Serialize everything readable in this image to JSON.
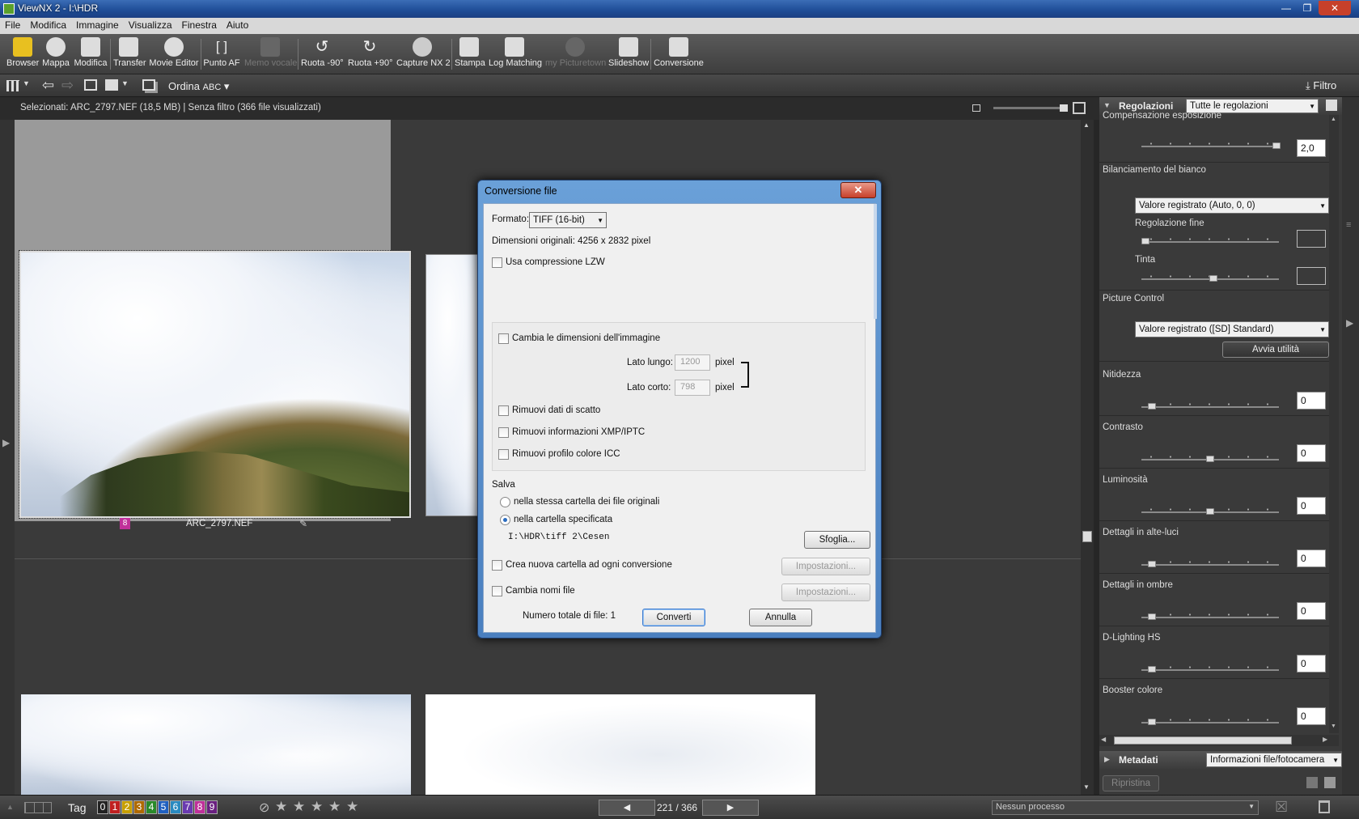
{
  "window": {
    "title": "ViewNX 2 - I:\\HDR"
  },
  "menu": [
    "File",
    "Modifica",
    "Immagine",
    "Visualizza",
    "Finestra",
    "Aiuto"
  ],
  "toolbar": {
    "buttons": [
      {
        "label": "Browser",
        "icon": "browser-icon"
      },
      {
        "label": "Mappa",
        "icon": "globe-icon"
      },
      {
        "label": "Modifica",
        "icon": "edit-icon"
      },
      {
        "label": "Transfer",
        "icon": "camera-icon"
      },
      {
        "label": "Movie Editor",
        "icon": "film-icon"
      },
      {
        "label": "Punto AF",
        "icon": "af-point-icon"
      },
      {
        "label": "Memo vocale",
        "icon": "voice-memo-icon",
        "disabled": true
      },
      {
        "label": "Ruota -90°",
        "icon": "rotate-left-icon"
      },
      {
        "label": "Ruota +90°",
        "icon": "rotate-right-icon"
      },
      {
        "label": "Capture NX 2",
        "icon": "nx-icon"
      },
      {
        "label": "Stampa",
        "icon": "print-icon"
      },
      {
        "label": "Log Matching",
        "icon": "log-matching-icon"
      },
      {
        "label": "my Picturetown",
        "icon": "picturetown-icon",
        "disabled": true
      },
      {
        "label": "Slideshow",
        "icon": "slideshow-icon"
      },
      {
        "label": "Conversione",
        "icon": "convert-icon"
      }
    ],
    "sort_label": "Ordina",
    "sort_value": "ABC",
    "filter_label": "Filtro"
  },
  "status": {
    "text": "Selezionati: ARC_2797.NEF (18,5 MB) | Senza filtro  (366 file visualizzati)"
  },
  "thumbnails": [
    {
      "name": "ARC_2797.NEF",
      "label": "8",
      "selected": true
    }
  ],
  "dialog": {
    "title": "Conversione file",
    "format_label": "Formato:",
    "format_value": "TIFF (16-bit)",
    "original_dims": "Dimensioni originali: 4256 x 2832 pixel",
    "lzw_label": "Usa compressione LZW",
    "resize_label": "Cambia le dimensioni dell'immagine",
    "long_side_label": "Lato lungo:",
    "long_side_value": "1200",
    "short_side_label": "Lato corto:",
    "short_side_value": "798",
    "pixel_unit": "pixel",
    "remove_shot_data": "Rimuovi dati di scatto",
    "remove_xmp": "Rimuovi informazioni XMP/IPTC",
    "remove_icc": "Rimuovi profilo colore ICC",
    "save_label": "Salva",
    "save_same_folder": "nella stessa cartella dei file originali",
    "save_specified": "nella cartella specificata",
    "save_path": "I:\\HDR\\tiff 2\\Cesen",
    "browse_button": "Sfoglia...",
    "new_folder_label": "Crea nuova cartella ad ogni conversione",
    "settings_button": "Impostazioni...",
    "rename_label": "Cambia nomi file",
    "total_files": "Numero totale di file: 1",
    "convert_button": "Converti",
    "cancel_button": "Annulla"
  },
  "panel": {
    "title": "Regolazioni",
    "preset": "Tutte le regolazioni",
    "exposure_label": "Compensazione esposizione",
    "exposure_value": "2,0",
    "wb_label": "Bilanciamento del bianco",
    "wb_value": "Valore registrato (Auto, 0, 0)",
    "fine_label": "Regolazione fine",
    "tint_label": "Tinta",
    "pc_label": "Picture Control",
    "pc_value": "Valore registrato ([SD] Standard)",
    "utility_button": "Avvia utilità",
    "sliders": [
      {
        "label": "Nitidezza",
        "value": "0",
        "pos": 0.05
      },
      {
        "label": "Contrasto",
        "value": "0",
        "pos": 0.5
      },
      {
        "label": "Luminosità",
        "value": "0",
        "pos": 0.5
      },
      {
        "label": "Dettagli in alte-luci",
        "value": "0",
        "pos": 0.05
      },
      {
        "label": "Dettagli in ombre",
        "value": "0",
        "pos": 0.05
      },
      {
        "label": "D-Lighting HS",
        "value": "0",
        "pos": 0.05
      },
      {
        "label": "Booster colore",
        "value": "0",
        "pos": 0.05
      }
    ],
    "metadata_title": "Metadati",
    "metadata_value": "Informazioni file/fotocamera",
    "reset_button": "Ripristina"
  },
  "bottom": {
    "tag_label": "Tag",
    "tags": [
      "0",
      "1",
      "2",
      "3",
      "4",
      "5",
      "6",
      "7",
      "8",
      "9"
    ],
    "tag_colors": [
      "#222",
      "#c02020",
      "#c8a000",
      "#b06a00",
      "#2a8a2a",
      "#2060c0",
      "#2a8ac0",
      "#6a3ab0",
      "#c0309a",
      "#6a2080"
    ],
    "page": "221 / 366",
    "process": "Nessun processo"
  }
}
